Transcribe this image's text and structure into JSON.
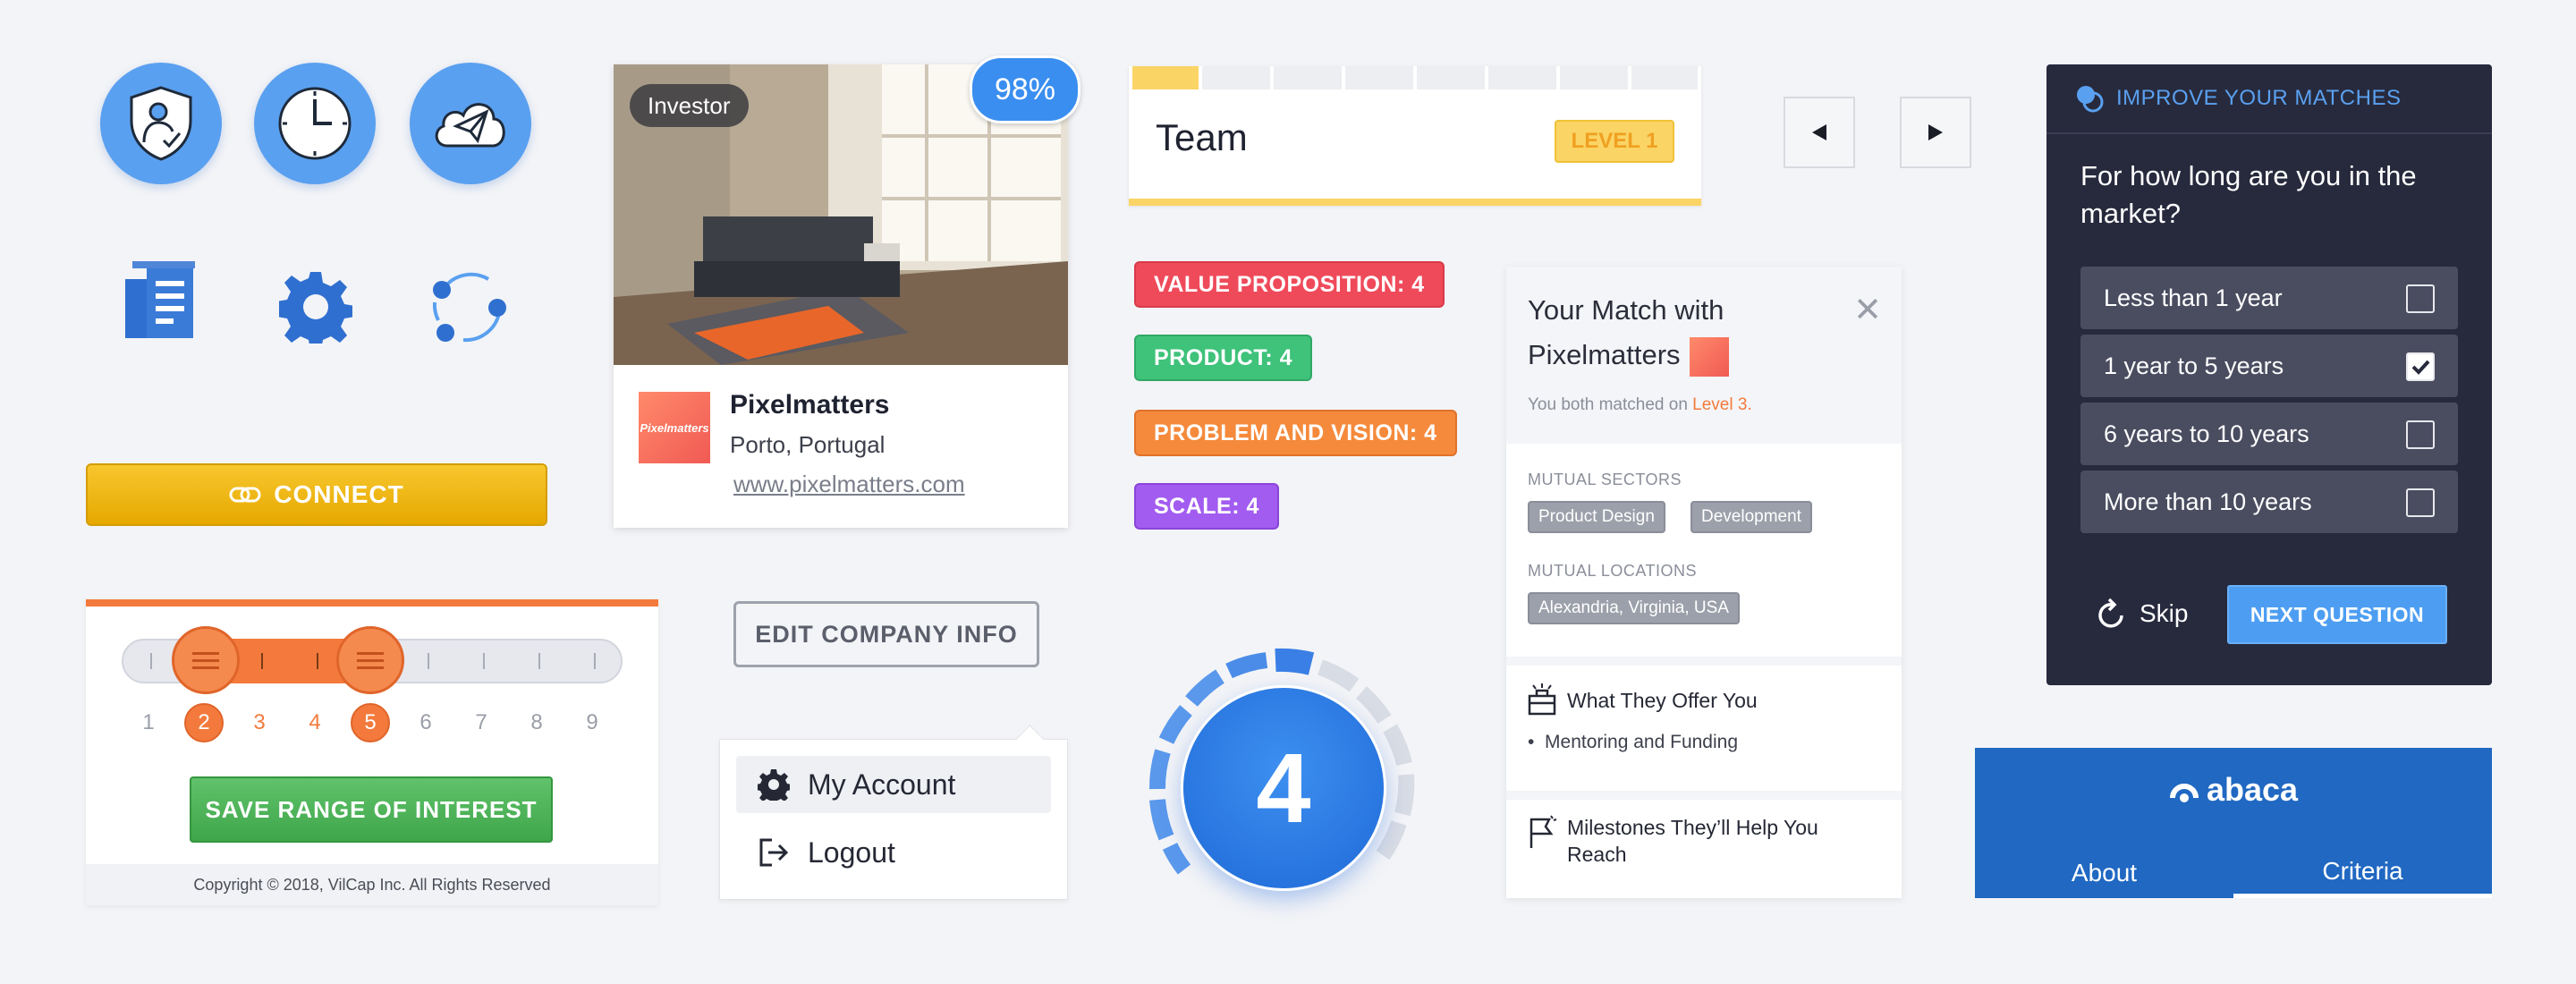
{
  "icons": [
    "shield-user-icon",
    "clock-icon",
    "paper-plane-cloud-icon",
    "document-icon",
    "gear-icon",
    "network-icon"
  ],
  "connect": {
    "label": "CONNECT"
  },
  "range": {
    "numbers": [
      "1",
      "2",
      "3",
      "4",
      "5",
      "6",
      "7",
      "8",
      "9"
    ],
    "selected": [
      2,
      5
    ],
    "save_label": "SAVE RANGE OF INTEREST",
    "copyright": "Copyright © 2018, VilCap Inc. All Rights Reserved"
  },
  "company": {
    "tag": "Investor",
    "match_percent": "98%",
    "logo_text": "Pixelmatters",
    "name": "Pixelmatters",
    "location": "Porto, Portugal",
    "url": "www.pixelmatters.com"
  },
  "edit_button": "EDIT COMPANY INFO",
  "account_menu": {
    "items": [
      {
        "label": "My Account"
      },
      {
        "label": "Logout"
      }
    ]
  },
  "team": {
    "label": "Team",
    "level": "LEVEL 1",
    "progress_segments": 8,
    "progress_filled": 1
  },
  "scores": [
    {
      "label": "VALUE PROPOSITION: 4",
      "color": "#ef4a5a"
    },
    {
      "label": "PRODUCT: 4",
      "color": "#3fc27a"
    },
    {
      "label": "PROBLEM AND VISION: 4",
      "color": "#f58a3c"
    },
    {
      "label": "SCALE: 4",
      "color": "#a25cf0"
    }
  ],
  "dial": {
    "value": "4"
  },
  "match": {
    "title_line1": "Your Match with",
    "title_line2": "Pixelmatters",
    "subtitle": "You both matched on ",
    "subtitle_level": "Level 3.",
    "sectors_heading": "MUTUAL SECTORS",
    "sectors": [
      "Product Design",
      "Development"
    ],
    "locations_heading": "MUTUAL LOCATIONS",
    "locations": [
      "Alexandria, Virginia, USA"
    ],
    "offer_title": "What They Offer You",
    "offer_item": "Mentoring and Funding",
    "milestones_title": "Milestones They’ll Help You Reach"
  },
  "quiz": {
    "header": "IMPROVE YOUR MATCHES",
    "question": "For how long are you in the market?",
    "options": [
      {
        "label": "Less than 1 year",
        "checked": false
      },
      {
        "label": "1 year to 5 years",
        "checked": true
      },
      {
        "label": "6 years to 10 years",
        "checked": false
      },
      {
        "label": "More than 10 years",
        "checked": false
      }
    ],
    "skip_label": "Skip",
    "next_label": "NEXT QUESTION"
  },
  "abaca": {
    "brand": "abaca",
    "tabs": [
      {
        "label": "About"
      },
      {
        "label": "Criteria"
      }
    ],
    "active_tab": 1
  }
}
